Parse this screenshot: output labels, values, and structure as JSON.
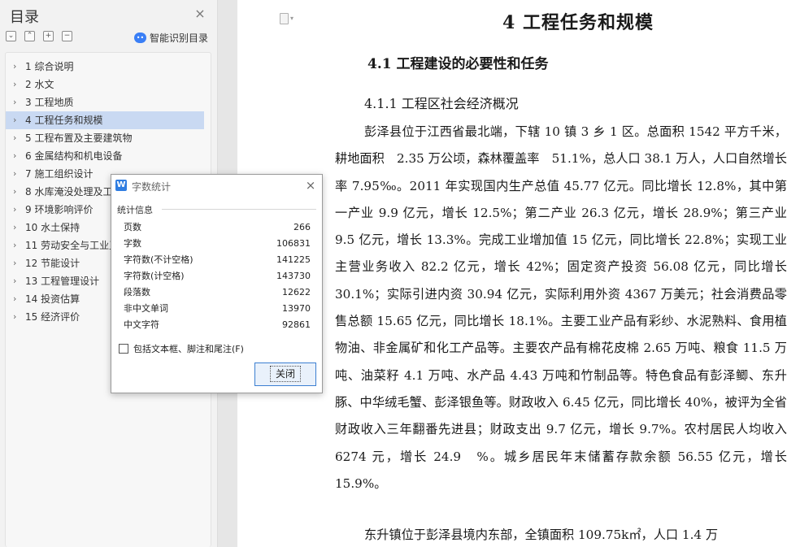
{
  "toc": {
    "title": "目录",
    "close_icon": "×",
    "tools": [
      "⌄",
      "⌃",
      "+",
      "−"
    ],
    "smart_label": "智能识别目录",
    "items": [
      {
        "label": "1 综合说明"
      },
      {
        "label": "2 水文"
      },
      {
        "label": "3 工程地质"
      },
      {
        "label": "4 工程任务和规模",
        "active": true
      },
      {
        "label": "5 工程布置及主要建筑物"
      },
      {
        "label": "6 金属结构和机电设备"
      },
      {
        "label": "7 施工组织设计"
      },
      {
        "label": "8 水库淹没处理及工"
      },
      {
        "label": "9 环境影响评价"
      },
      {
        "label": "10 水土保持"
      },
      {
        "label": "11 劳动安全与工业卫"
      },
      {
        "label": "12 节能设计"
      },
      {
        "label": "13 工程管理设计"
      },
      {
        "label": "14 投资估算"
      },
      {
        "label": "15 经济评价"
      }
    ]
  },
  "document": {
    "heading1": "4 工程任务和规模",
    "heading2": "4.1 工程建设的必要性和任务",
    "heading3": "4.1.1 工程区社会经济概况",
    "paragraph1": "彭泽县位于江西省最北端，下辖 10 镇 3 乡 1 区。总面积 1542 平方千米，耕地面积　2.35 万公顷，森林覆盖率　51.1%，总人口 38.1 万人，人口自然增长率 7.95‰。2011 年实现国内生产总值 45.77 亿元。同比增长 12.8%，其中第一产业 9.9 亿元，增长 12.5%；第二产业 26.3 亿元，增长 28.9%；第三产业 9.5 亿元，增长 13.3%。完成工业增加值 15 亿元，同比增长 22.8%；实现工业主营业务收入 82.2 亿元，增长 42%；固定资产投资 56.08 亿元，同比增长 30.1%；实际引进内资 30.94 亿元，实际利用外资 4367 万美元；社会消费品零售总额 15.65 亿元，同比增长 18.1%。主要工业产品有彩纱、水泥熟料、食用植物油、非金属矿和化工产品等。主要农产品有棉花皮棉 2.65 万吨、粮食 11.5 万吨、油菜籽 4.1 万吨、水产品 4.43 万吨和竹制品等。特色食品有彭泽鲫、东升豚、中华绒毛蟹、彭泽银鱼等。财政收入 6.45 亿元，同比增长 40%，被评为全省财政收入三年翻番先进县；财政支出 9.7 亿元，增长 9.7%。农村居民人均收入 6274 元，增长 24.9　%。城乡居民年末储蓄存款余额 56.55 亿元，增长 15.9%。",
    "paragraph2": "东升镇位于彭泽县境内东部，全镇面积 109.75k㎡，人口 1.4 万"
  },
  "dialog": {
    "title": "字数统计",
    "logo": "W",
    "close_icon": "×",
    "section_label": "统计信息",
    "stats": [
      {
        "label": "页数",
        "value": "266"
      },
      {
        "label": "字数",
        "value": "106831"
      },
      {
        "label": "字符数(不计空格)",
        "value": "141225"
      },
      {
        "label": "字符数(计空格)",
        "value": "143730"
      },
      {
        "label": "段落数",
        "value": "12622"
      },
      {
        "label": "非中文单词",
        "value": "13970"
      },
      {
        "label": "中文字符",
        "value": "92861"
      }
    ],
    "checkbox_label": "包括文本框、脚注和尾注(F)",
    "checkbox_checked": false,
    "close_button": "关闭"
  }
}
